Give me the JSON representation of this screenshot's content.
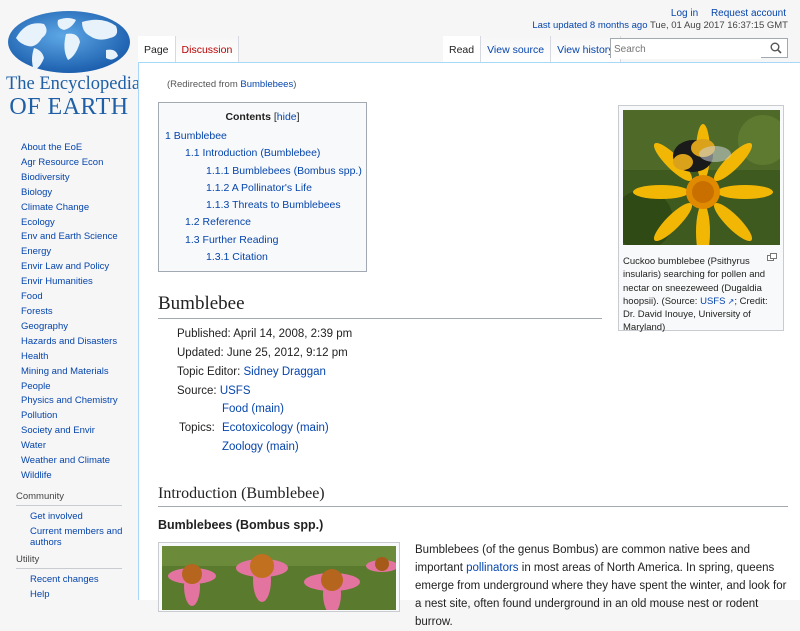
{
  "logo": {
    "line1": "The Encyclopedia",
    "line2": "OF EARTH"
  },
  "sidebar": {
    "nav": [
      "About the EoE",
      "Agr Resource Econ",
      "Biodiversity",
      "Biology",
      "Climate Change",
      "Ecology",
      "Env and Earth Science",
      "Energy",
      "Envir Law and Policy",
      "Envir Humanities",
      "Food",
      "Forests",
      "Geography",
      "Hazards and Disasters",
      "Health",
      "Mining and Materials",
      "People",
      "Physics and Chemistry",
      "Pollution",
      "Society and Envir",
      "Water",
      "Weather and Climate",
      "Wildlife"
    ],
    "community": {
      "heading": "Community",
      "items": [
        "Get involved",
        "Current members and authors"
      ]
    },
    "utility": {
      "heading": "Utility",
      "items": [
        "Recent changes",
        "Help"
      ]
    }
  },
  "header": {
    "login": "Log in",
    "request": "Request account",
    "last_updated_link": "Last updated 8 months ago",
    "last_updated_date": "Tue, 01 Aug 2017 16:37:15 GMT",
    "tabs_left": [
      "Page",
      "Discussion"
    ],
    "tabs_right": [
      "Read",
      "View source",
      "View history"
    ],
    "search_placeholder": "Search"
  },
  "content": {
    "redirected_prefix": "(Redirected from ",
    "redirected_link": "Bumblebees",
    "redirected_suffix": ")",
    "toc": {
      "title": "Contents",
      "hide": "hide",
      "items": [
        {
          "num": "1",
          "text": "Bumblebee"
        },
        {
          "num": "1.1",
          "text": "Introduction (Bumblebee)"
        },
        {
          "num": "1.1.1",
          "text": "Bumblebees (Bombus spp.)"
        },
        {
          "num": "1.1.2",
          "text": "A Pollinator's Life"
        },
        {
          "num": "1.1.3",
          "text": "Threats to Bumblebees"
        },
        {
          "num": "1.2",
          "text": "Reference"
        },
        {
          "num": "1.3",
          "text": "Further Reading"
        },
        {
          "num": "1.3.1",
          "text": "Citation"
        }
      ]
    },
    "thumb": {
      "caption_start": "Cuckoo bumblebee (Psithyrus insularis) searching for pollen and nectar on sneezeweed (Dugaldia hoopsii). (Source: ",
      "caption_link": "USFS",
      "caption_end": "; Credit: Dr. David Inouye, University of Maryland)"
    },
    "title": "Bumblebee",
    "meta": {
      "published": "Published: April 14, 2008, 2:39 pm",
      "updated": "Updated: June 25, 2012, 9:12 pm",
      "editor_label": "Topic Editor: ",
      "editor": "Sidney Draggan",
      "source_label": "Source: ",
      "source": "USFS"
    },
    "topics": {
      "label": "Topics:",
      "items": [
        "Food (main)",
        "Ecotoxicology (main)",
        "Zoology (main)"
      ]
    },
    "intro_heading": "Introduction (Bumblebee)",
    "sub_heading": "Bumblebees (Bombus spp.)",
    "para": {
      "p1": "Bumblebees (of the genus Bombus) are common native bees and important ",
      "link": "pollinators",
      "p2": " in most areas of North America. In spring, queens emerge from underground where they have spent the winter, and look for a nest site, often found underground in an old mouse nest or rodent burrow."
    }
  }
}
